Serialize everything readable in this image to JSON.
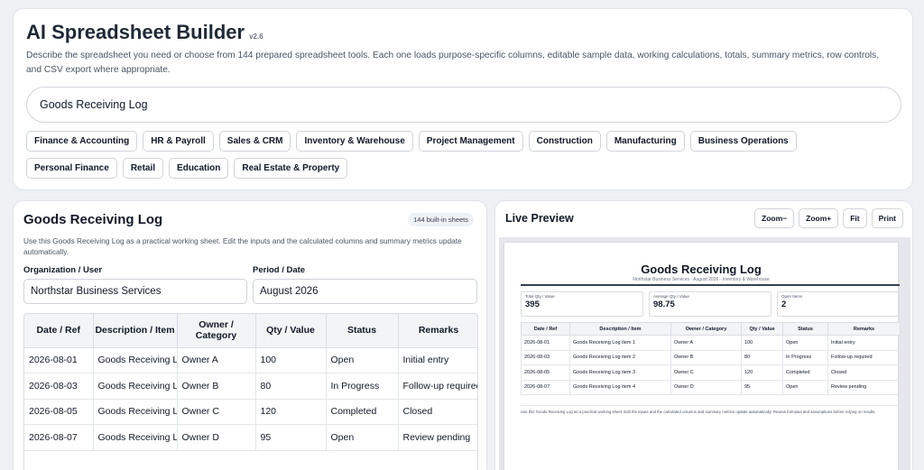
{
  "app": {
    "title": "AI Spreadsheet Builder",
    "version": "v2.6",
    "description": "Describe the spreadsheet you need or choose from 144 prepared spreadsheet tools. Each one loads purpose-specific columns, editable sample data, working calculations, totals, summary metrics, row controls, and CSV export where appropriate.",
    "search_value": "Goods Receiving Log"
  },
  "categories": [
    "Finance & Accounting",
    "HR & Payroll",
    "Sales & CRM",
    "Inventory & Warehouse",
    "Project Management",
    "Construction",
    "Manufacturing",
    "Business Operations",
    "Personal Finance",
    "Retail",
    "Education",
    "Real Estate & Property"
  ],
  "sheet": {
    "title": "Goods Receiving Log",
    "badge": "144 built-in sheets",
    "description": "Use this Goods Receiving Log as a practical working sheet. Edit the inputs and the calculated columns and summary metrics update automatically.",
    "org_label": "Organization / User",
    "org_value": "Northstar Business Services",
    "period_label": "Period / Date",
    "period_value": "August 2026",
    "columns": [
      "Date / Ref",
      "Description / Item",
      "Owner / Category",
      "Qty / Value",
      "Status",
      "Remarks"
    ],
    "rows": [
      [
        "2026-08-01",
        "Goods Receiving Log item 1",
        "Owner A",
        "100",
        "Open",
        "Initial entry"
      ],
      [
        "2026-08-03",
        "Goods Receiving Log item 2",
        "Owner B",
        "80",
        "In Progress",
        "Follow-up required"
      ],
      [
        "2026-08-05",
        "Goods Receiving Log item 3",
        "Owner C",
        "120",
        "Completed",
        "Closed"
      ],
      [
        "2026-08-07",
        "Goods Receiving Log item 4",
        "Owner D",
        "95",
        "Open",
        "Review pending"
      ]
    ]
  },
  "preview": {
    "title": "Live Preview",
    "buttons": [
      "Zoom−",
      "Zoom+",
      "Fit",
      "Print"
    ],
    "doc_title": "Goods Receiving Log",
    "doc_subtitle": "Northstar Business Services · August 2026 · Inventory & Warehouse",
    "metrics": [
      {
        "label": "Total Qty / Value",
        "value": "395"
      },
      {
        "label": "Average Qty / Value",
        "value": "98.75"
      },
      {
        "label": "Open Items",
        "value": "2"
      }
    ],
    "note": "Use this Goods Receiving Log as a practical working sheet. Edit the inputs and the calculated columns and summary metrics update automatically. Review formulas and assumptions before relying on results."
  }
}
